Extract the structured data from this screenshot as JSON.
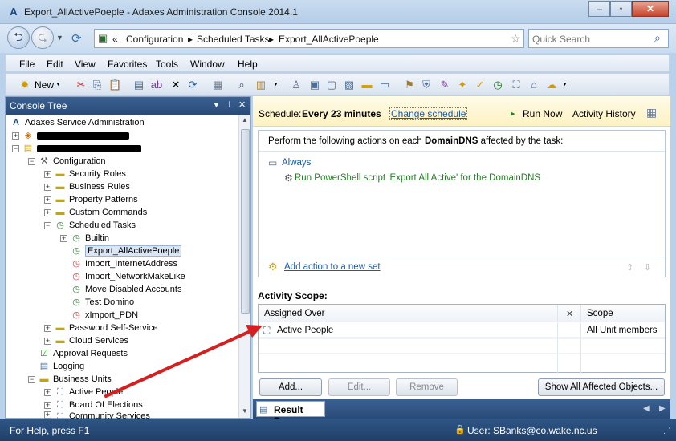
{
  "window": {
    "title": "Export_AllActivePoeple - Adaxes Administration Console 2014.1",
    "app_icon": "adaxes-icon"
  },
  "addressbar": {
    "chevron": "«",
    "crumbs": [
      "Configuration",
      "Scheduled Tasks",
      "Export_AllActivePoeple"
    ],
    "separator": "▸",
    "quick_search_placeholder": "Quick Search"
  },
  "menu": [
    "File",
    "Edit",
    "View",
    "Favorites",
    "Tools",
    "Window",
    "Help"
  ],
  "toolbar": {
    "new_label": "New"
  },
  "tree": {
    "title": "Console Tree",
    "root": "Adaxes Service Administration",
    "configuration": "Configuration",
    "config_items": [
      "Security Roles",
      "Business Rules",
      "Property Patterns",
      "Custom Commands"
    ],
    "scheduled_tasks": "Scheduled Tasks",
    "builtin": "Builtin",
    "tasks": [
      "Export_AllActivePoeple",
      "Import_InternetAddress",
      "Import_NetworkMakeLike",
      "Move Disabled Accounts",
      "Test Domino",
      "xImport_PDN"
    ],
    "after_tasks": [
      "Password Self-Service",
      "Cloud Services"
    ],
    "approval_requests": "Approval Requests",
    "logging": "Logging",
    "business_units": "Business Units",
    "units": [
      "Active People",
      "Board Of Elections",
      "Community Services"
    ]
  },
  "schedule": {
    "label": "Schedule:",
    "value": "Every 23 minutes",
    "change_link": "Change schedule",
    "run_now": "Run Now",
    "activity_history": "Activity History"
  },
  "actions": {
    "header_prefix": "Perform the following actions on each ",
    "object_type": "DomainDNS",
    "header_suffix": " affected by the task:",
    "condition": "Always",
    "action": "Run PowerShell script 'Export All Active' for the DomainDNS",
    "add_action_link": "Add action to a new set"
  },
  "scope": {
    "title": "Activity Scope:",
    "col_assigned": "Assigned Over",
    "col_x": "✕",
    "col_scope": "Scope",
    "rows": [
      {
        "assigned": "Active People",
        "scope": "All Unit members"
      }
    ]
  },
  "buttons": {
    "add": "Add...",
    "edit": "Edit...",
    "remove": "Remove",
    "show_all": "Show All Affected Objects..."
  },
  "result_tab": "Result Pane",
  "status": {
    "help": "For Help, press F1",
    "user": "User: SBanks@co.wake.nc.us"
  },
  "colors": {
    "accent": "#2a4b78",
    "link": "#1c5aa8",
    "green_text": "#2a7a2a",
    "annotation_arrow": "#d42020"
  }
}
